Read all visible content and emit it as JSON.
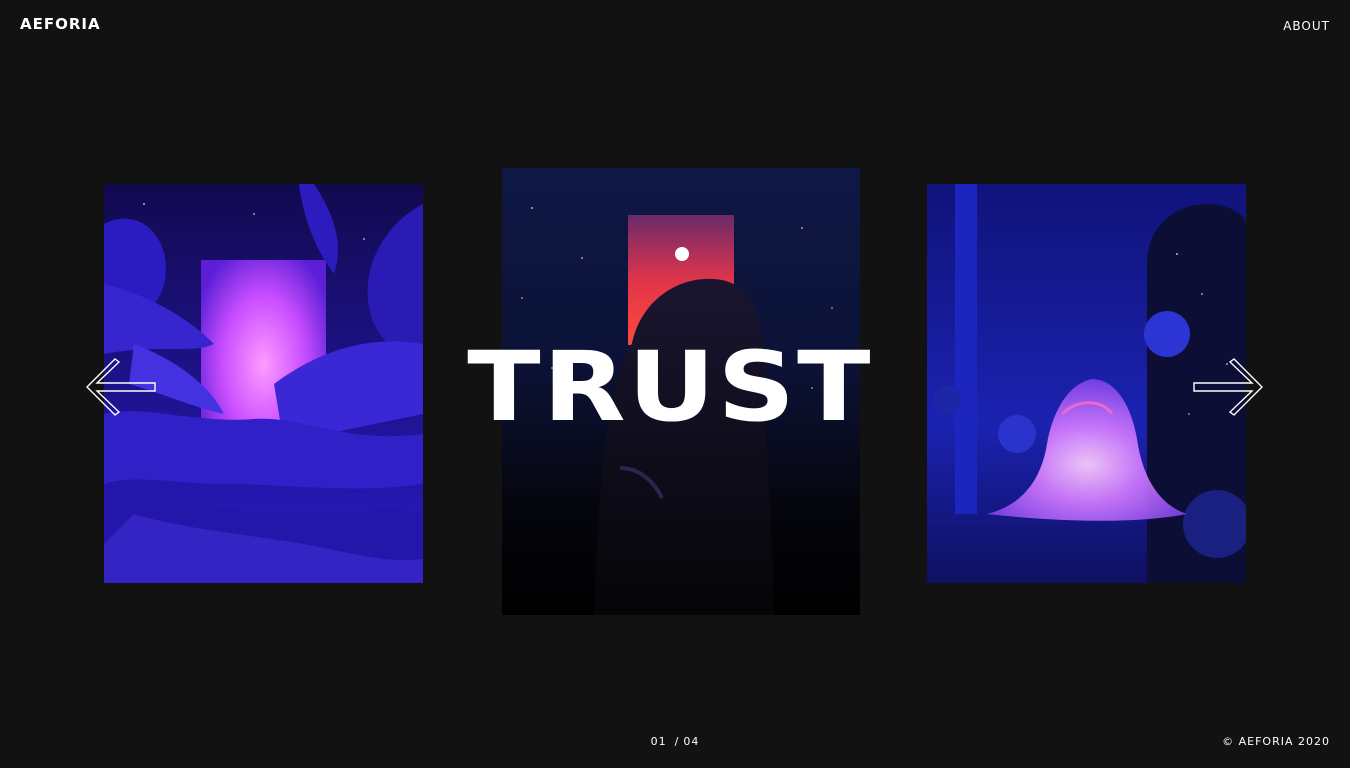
{
  "header": {
    "logo": "AEFORIA",
    "nav_about": "ABOUT"
  },
  "slider": {
    "headline": "TRUST",
    "current_page": "01",
    "separator": "/",
    "total_pages": "04",
    "prev_icon": "arrow-left-icon",
    "next_icon": "arrow-right-icon"
  },
  "footer": {
    "copyright": "© AEFORIA 2020"
  },
  "colors": {
    "background": "#121212",
    "text": "#ffffff",
    "accent_purple": "#2d1fd0",
    "accent_pink": "#e055ff",
    "accent_red": "#ff3b3b"
  }
}
